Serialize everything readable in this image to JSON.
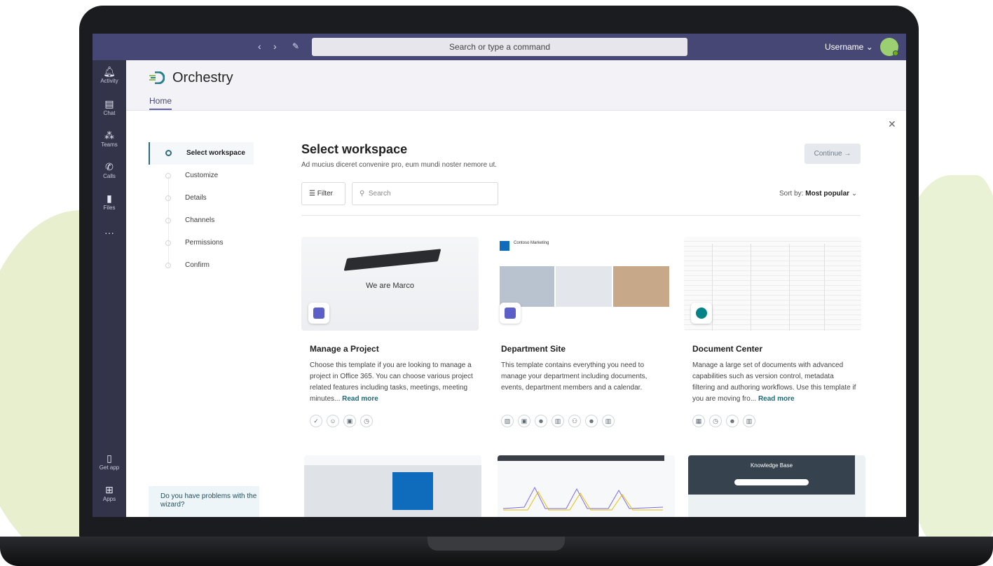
{
  "topbar": {
    "search_placeholder": "Search or type a command",
    "username": "Username"
  },
  "rail": {
    "items": [
      {
        "label": "Activity",
        "icon": "bell-icon"
      },
      {
        "label": "Chat",
        "icon": "chat-icon"
      },
      {
        "label": "Teams",
        "icon": "teams-icon"
      },
      {
        "label": "Calls",
        "icon": "phone-icon"
      },
      {
        "label": "Files",
        "icon": "file-icon"
      },
      {
        "label": "",
        "icon": "more-icon"
      }
    ],
    "bottom": [
      {
        "label": "Get app",
        "icon": "mobile-icon"
      },
      {
        "label": "Apps",
        "icon": "apps-icon"
      }
    ]
  },
  "header": {
    "title": "Orchestry",
    "tab": "Home"
  },
  "wizard": {
    "steps": [
      "Select workspace",
      "Customize",
      "Details",
      "Channels",
      "Permissions",
      "Confirm"
    ],
    "help": "Do you have problems with the wizard?"
  },
  "main": {
    "title": "Select workspace",
    "subtitle": "Ad mucius diceret convenire pro, eum mundi noster nemore ut.",
    "continue": "Continue",
    "filter": "Filter",
    "search_placeholder": "Search",
    "sort_label": "Sort by:",
    "sort_value": "Most popular"
  },
  "cards": [
    {
      "title": "Manage a Project",
      "desc": "Choose this template if you are looking to manage a project in Office 365. You can choose various project related features including tasks, meetings, meeting minutes...",
      "readmore": "Read more",
      "thumb_text": "We are Marco",
      "badge_color": "#5b5fc7"
    },
    {
      "title": "Department Site",
      "desc": "This template contains everything you need to manage your department including documents, events, department members and a calendar.",
      "readmore": "",
      "thumb_text": "Contoso Marketing",
      "badge_color": "#5b5fc7"
    },
    {
      "title": "Document Center",
      "desc": "Manage a large set of documents with advanced capabilities such as version control, metadata filtering and authoring workflows. Use this template if you are moving fro...",
      "readmore": "Read more",
      "thumb_text": "",
      "badge_color": "#038387"
    }
  ],
  "row2": {
    "knowledge_title": "Knowledge Base"
  }
}
